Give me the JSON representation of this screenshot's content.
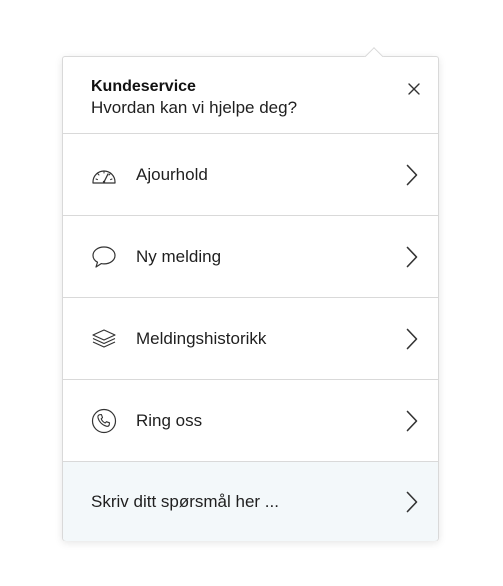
{
  "header": {
    "title": "Kundeservice",
    "subtitle": "Hvordan kan vi hjelpe deg?",
    "close_icon": "close-icon"
  },
  "menu": {
    "items": [
      {
        "label": "Ajourhold",
        "icon": "speedometer-icon"
      },
      {
        "label": "Ny melding",
        "icon": "speech-bubble-icon"
      },
      {
        "label": "Meldingshistorikk",
        "icon": "layers-icon"
      },
      {
        "label": "Ring oss",
        "icon": "phone-icon"
      }
    ],
    "ask": {
      "label": "Skriv ditt spørsmål her ..."
    }
  },
  "colors": {
    "border": "#d9d9d9",
    "text": "#1f1f1f",
    "ask_background": "#f3f8fa"
  }
}
